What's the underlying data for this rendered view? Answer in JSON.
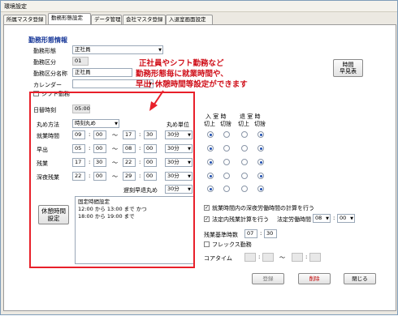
{
  "window": {
    "title": "環境設定"
  },
  "tabs": [
    "所属マスタ登録",
    "勤務形態設定",
    "データ管理",
    "会社マスタ登録",
    "入退室画面設定"
  ],
  "section_title": "勤務形態情報",
  "form": {
    "kinmu_label": "勤務形態",
    "kinmu_value": "正社員",
    "kubun_label": "勤務区分",
    "kubun_value": "01",
    "kubun_name_label": "勤務区分名称",
    "kubun_name_value": "正社員",
    "calendar_label": "カレンダー",
    "shift_label": "シフト勤務",
    "nichiji_label": "日替時刻",
    "nichiji_value": "05:00"
  },
  "jikan_button": "時間\n早見表",
  "callout": [
    "正社員やシフト勤務など",
    "勤務形態毎に就業時間や、",
    "早出･休憩時間等設定ができます"
  ],
  "rounding": {
    "method_label": "丸め方法",
    "method_value": "時刻丸め",
    "unit_label": "丸め単位",
    "tilde": "～",
    "rows": [
      {
        "label": "就業時間",
        "h1": "09",
        "m1": "00",
        "h2": "17",
        "m2": "30",
        "unit": "30分"
      },
      {
        "label": "早出",
        "h1": "05",
        "m1": "00",
        "h2": "08",
        "m2": "00",
        "unit": "30分"
      },
      {
        "label": "残業",
        "h1": "17",
        "m1": "30",
        "h2": "22",
        "m2": "00",
        "unit": "30分"
      },
      {
        "label": "深夜残業",
        "h1": "22",
        "m1": "00",
        "h2": "29",
        "m2": "00",
        "unit": "30分"
      }
    ],
    "chikoku_label": "遅刻早退丸め",
    "chikoku_unit": "30分"
  },
  "columns": {
    "nyushitsu": "入 室 時",
    "taishitsu": "退 室 時",
    "kiriage": "切上",
    "kirisute": "切捨"
  },
  "kyukei": {
    "button": "休憩時間\n設定",
    "note": [
      "固定時間設定",
      "12:00 から 13:00 まで  かつ",
      "18:00 から 19:00 まで"
    ]
  },
  "options": {
    "opt1": "就業時間内の深夜労働時間の計算を行う",
    "opt2": "法定内残業計算を行う",
    "houtei_label": "法定労働時間",
    "houtei_h": "08",
    "houtei_m": "00",
    "zangyo_label": "残業基準時数",
    "zangyo_h": "07",
    "zangyo_m": "30",
    "flex_label": "フレックス勤務",
    "core_label": "コアタイム",
    "core_tilde": "～"
  },
  "buttons": {
    "register": "登録",
    "delete": "削除",
    "close": "閉じる"
  }
}
